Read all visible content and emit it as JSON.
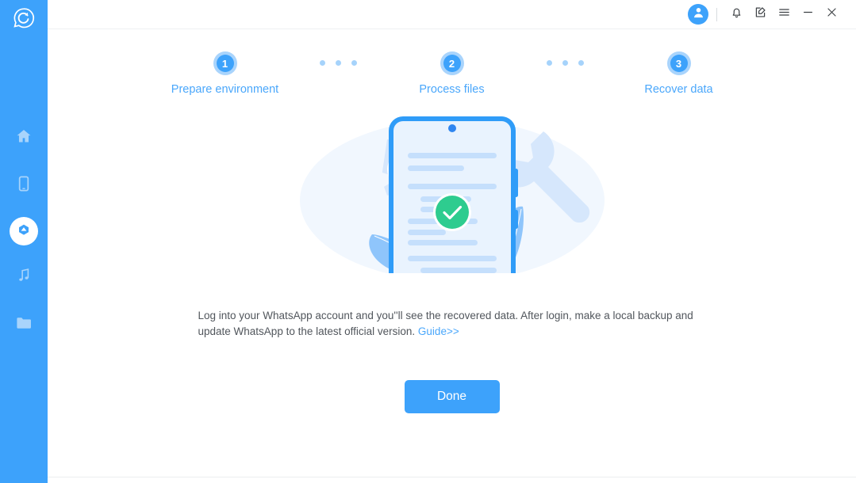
{
  "app": {
    "logo_icon": "whatsapp-recovery-logo-icon",
    "accent_color": "#3da2fb",
    "sidebar_color": "#3da2fb",
    "link_color": "#4aa7fb",
    "success_color": "#2ecc8f"
  },
  "sidebar": {
    "items": [
      {
        "name": "home",
        "icon": "home-icon",
        "active": false
      },
      {
        "name": "device",
        "icon": "phone-icon",
        "active": false
      },
      {
        "name": "recover",
        "icon": "cloud-recover-icon",
        "active": true
      },
      {
        "name": "music",
        "icon": "music-note-icon",
        "active": false
      },
      {
        "name": "files",
        "icon": "folder-icon",
        "active": false
      }
    ]
  },
  "titlebar": {
    "account_icon": "user-avatar-icon",
    "notification_icon": "bell-icon",
    "feedback_icon": "edit-note-icon",
    "menu_icon": "hamburger-menu-icon",
    "minimize_icon": "minimize-icon",
    "close_icon": "close-icon"
  },
  "stepper": {
    "steps": [
      {
        "number": "1",
        "label": "Prepare environment"
      },
      {
        "number": "2",
        "label": "Process files"
      },
      {
        "number": "3",
        "label": "Recover data"
      }
    ],
    "dots": [
      "dot",
      "dot",
      "dot"
    ]
  },
  "illustration": {
    "name": "phone-document-success-illustration",
    "status_icon": "green-check-circle-icon",
    "decor": [
      "gear-icon",
      "wrench-icon",
      "leaf-icon",
      "leaf-icon"
    ]
  },
  "content": {
    "description_part1": "Log into your WhatsApp account and you''ll see the recovered data. After login, make a local backup and update WhatsApp to the latest official version. ",
    "guide_link": "Guide>>"
  },
  "footer": {
    "done_label": "Done"
  }
}
